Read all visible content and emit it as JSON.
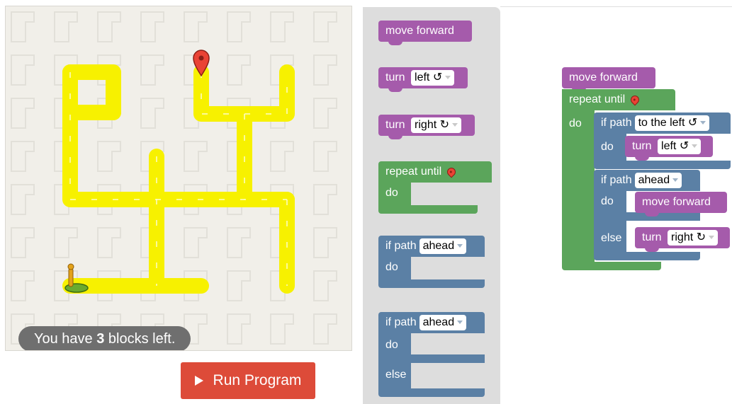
{
  "maze": {
    "status_prefix": "You have ",
    "blocks_left": "3",
    "status_suffix": " blocks left.",
    "player_icon": "pegman-player-icon",
    "goal_icon": "goal-marker-icon"
  },
  "run_button": {
    "label": "Run Program",
    "icon": "play-icon"
  },
  "colors": {
    "motion": "#a55bab",
    "loop": "#5ba55b",
    "logic": "#5b80a5",
    "path": "#f7f100",
    "run": "#dd4b39"
  },
  "toolbox": {
    "move_forward": "move forward",
    "turn_left": {
      "label": "turn",
      "value": "left ↺"
    },
    "turn_right": {
      "label": "turn",
      "value": "right ↻"
    },
    "repeat_until": {
      "label": "repeat until",
      "do": "do"
    },
    "if_path": {
      "label": "if path",
      "value": "ahead",
      "do": "do"
    },
    "if_else": {
      "label": "if path",
      "value": "ahead",
      "do": "do",
      "else": "else"
    }
  },
  "workspace": {
    "move_forward": "move forward",
    "repeat_until": {
      "label": "repeat until",
      "do": "do"
    },
    "if_left": {
      "label": "if path",
      "value": "to the left ↺",
      "do": "do",
      "inner": {
        "label": "turn",
        "value": "left ↺"
      }
    },
    "if_ahead": {
      "label": "if path",
      "value": "ahead",
      "do": "do",
      "else": "else",
      "inner_do": "move forward",
      "inner_else": {
        "label": "turn",
        "value": "right ↻"
      }
    }
  }
}
